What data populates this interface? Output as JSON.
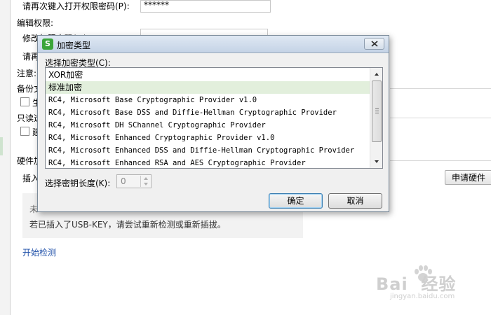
{
  "background": {
    "reopen_password_label": "请再次键入打开权限密码(P):",
    "reopen_password_value": "******",
    "edit_permission_label": "编辑权限:",
    "modify_password_label": "修改权限密码(M):",
    "reenter_label_partial": "请再",
    "notice_partial": "注意:",
    "backup_partial": "备份文",
    "generate_partial": "生",
    "readonly_partial": "只读选",
    "suggest_partial": "建",
    "hardware_partial": "硬件加",
    "insert_partial": "插入",
    "apply_hardware_button": "申请硬件",
    "info_line1_partial": "未",
    "info_line2": "若已插入了USB-KEY，请尝试重新检测或重新插拔。",
    "start_detect_link": "开始检测",
    "watermark_big": "Bai  经验",
    "watermark_small": "jingyan.baidu.com"
  },
  "dialog": {
    "title": "加密类型",
    "icon_letter": "S",
    "select_type_label": "选择加密类型(C):",
    "encryption_types": [
      "XOR加密",
      "标准加密",
      "RC4, Microsoft Base Cryptographic Provider v1.0",
      "RC4, Microsoft Base DSS and Diffie-Hellman Cryptographic Provider",
      "RC4, Microsoft DH SChannel Cryptographic Provider",
      "RC4, Microsoft Enhanced Cryptographic Provider v1.0",
      "RC4, Microsoft Enhanced DSS and Diffie-Hellman Cryptographic Provider",
      "RC4, Microsoft Enhanced RSA and AES Cryptographic Provider"
    ],
    "selected_index": 1,
    "key_length_label": "选择密钥长度(K):",
    "key_length_value": "0",
    "ok_label": "确定",
    "cancel_label": "取消"
  },
  "colors": {
    "selected_row": "#e2efdc",
    "link": "#1e4fa8",
    "titlebar": "#c4d3e6"
  }
}
